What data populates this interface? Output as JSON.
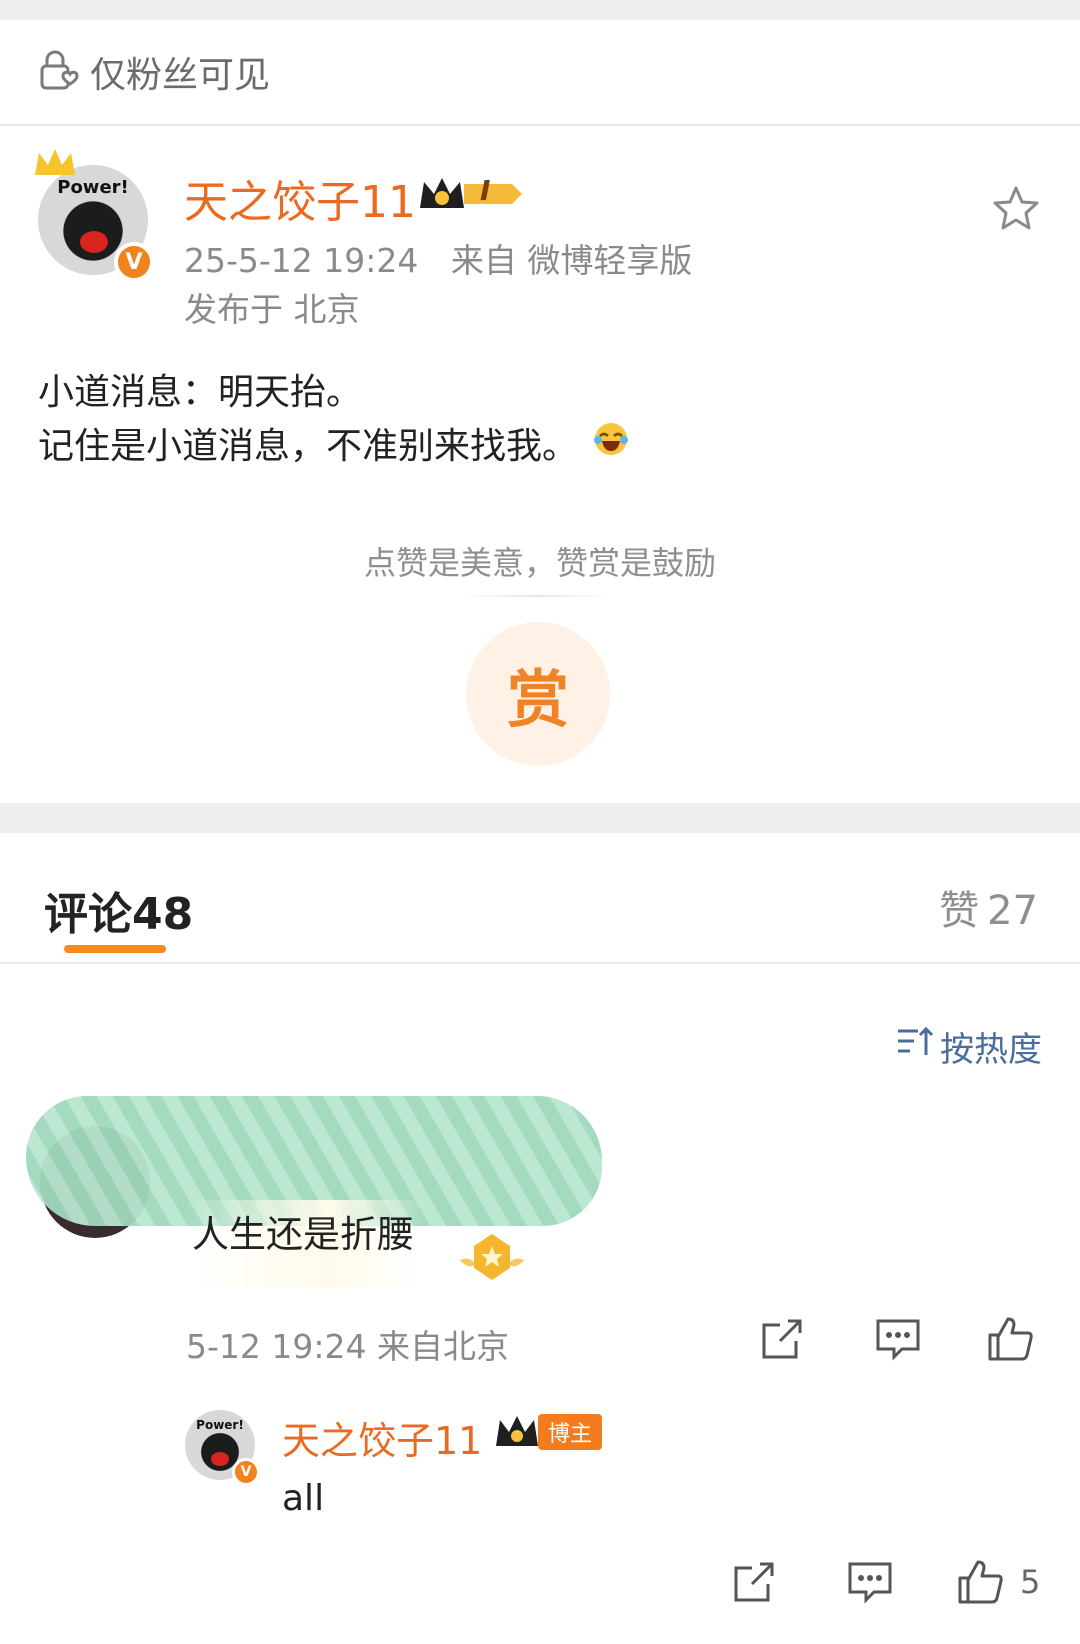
{
  "visibility": {
    "icon": "lock-heart-icon",
    "label": "仅粉丝可见"
  },
  "post": {
    "author": "天之饺子11",
    "author_avatar_text": "Power!",
    "level_badge": "I",
    "datetime": "25-5-12 19:24",
    "source": "来自 微博轻享版",
    "location": "发布于 北京",
    "lines": [
      "小道消息：明天抬。",
      "记住是小道消息，不准别来找我。"
    ],
    "emoji": "laughing-tears-icon"
  },
  "reward": {
    "hint": "点赞是美意，赞赏是鼓励",
    "button": "赏"
  },
  "tabs": {
    "comments_label": "评论",
    "comments_count": "48",
    "likes_label": "赞",
    "likes_count": "27"
  },
  "sort": {
    "label": "按热度"
  },
  "comments": [
    {
      "text": "人生还是折腰",
      "meta": "5-12 19:24  来自北京",
      "actions": [
        "share-icon",
        "comment-icon",
        "like-icon"
      ],
      "reply": {
        "author": "天之饺子11",
        "avatar_text": "Power!",
        "tag": "博主",
        "text": "all",
        "like_count": "5"
      }
    }
  ],
  "colors": {
    "accent": "#f68b20",
    "username": "#ea6a22",
    "link": "#4a6d9c",
    "divider": "#efefef"
  }
}
